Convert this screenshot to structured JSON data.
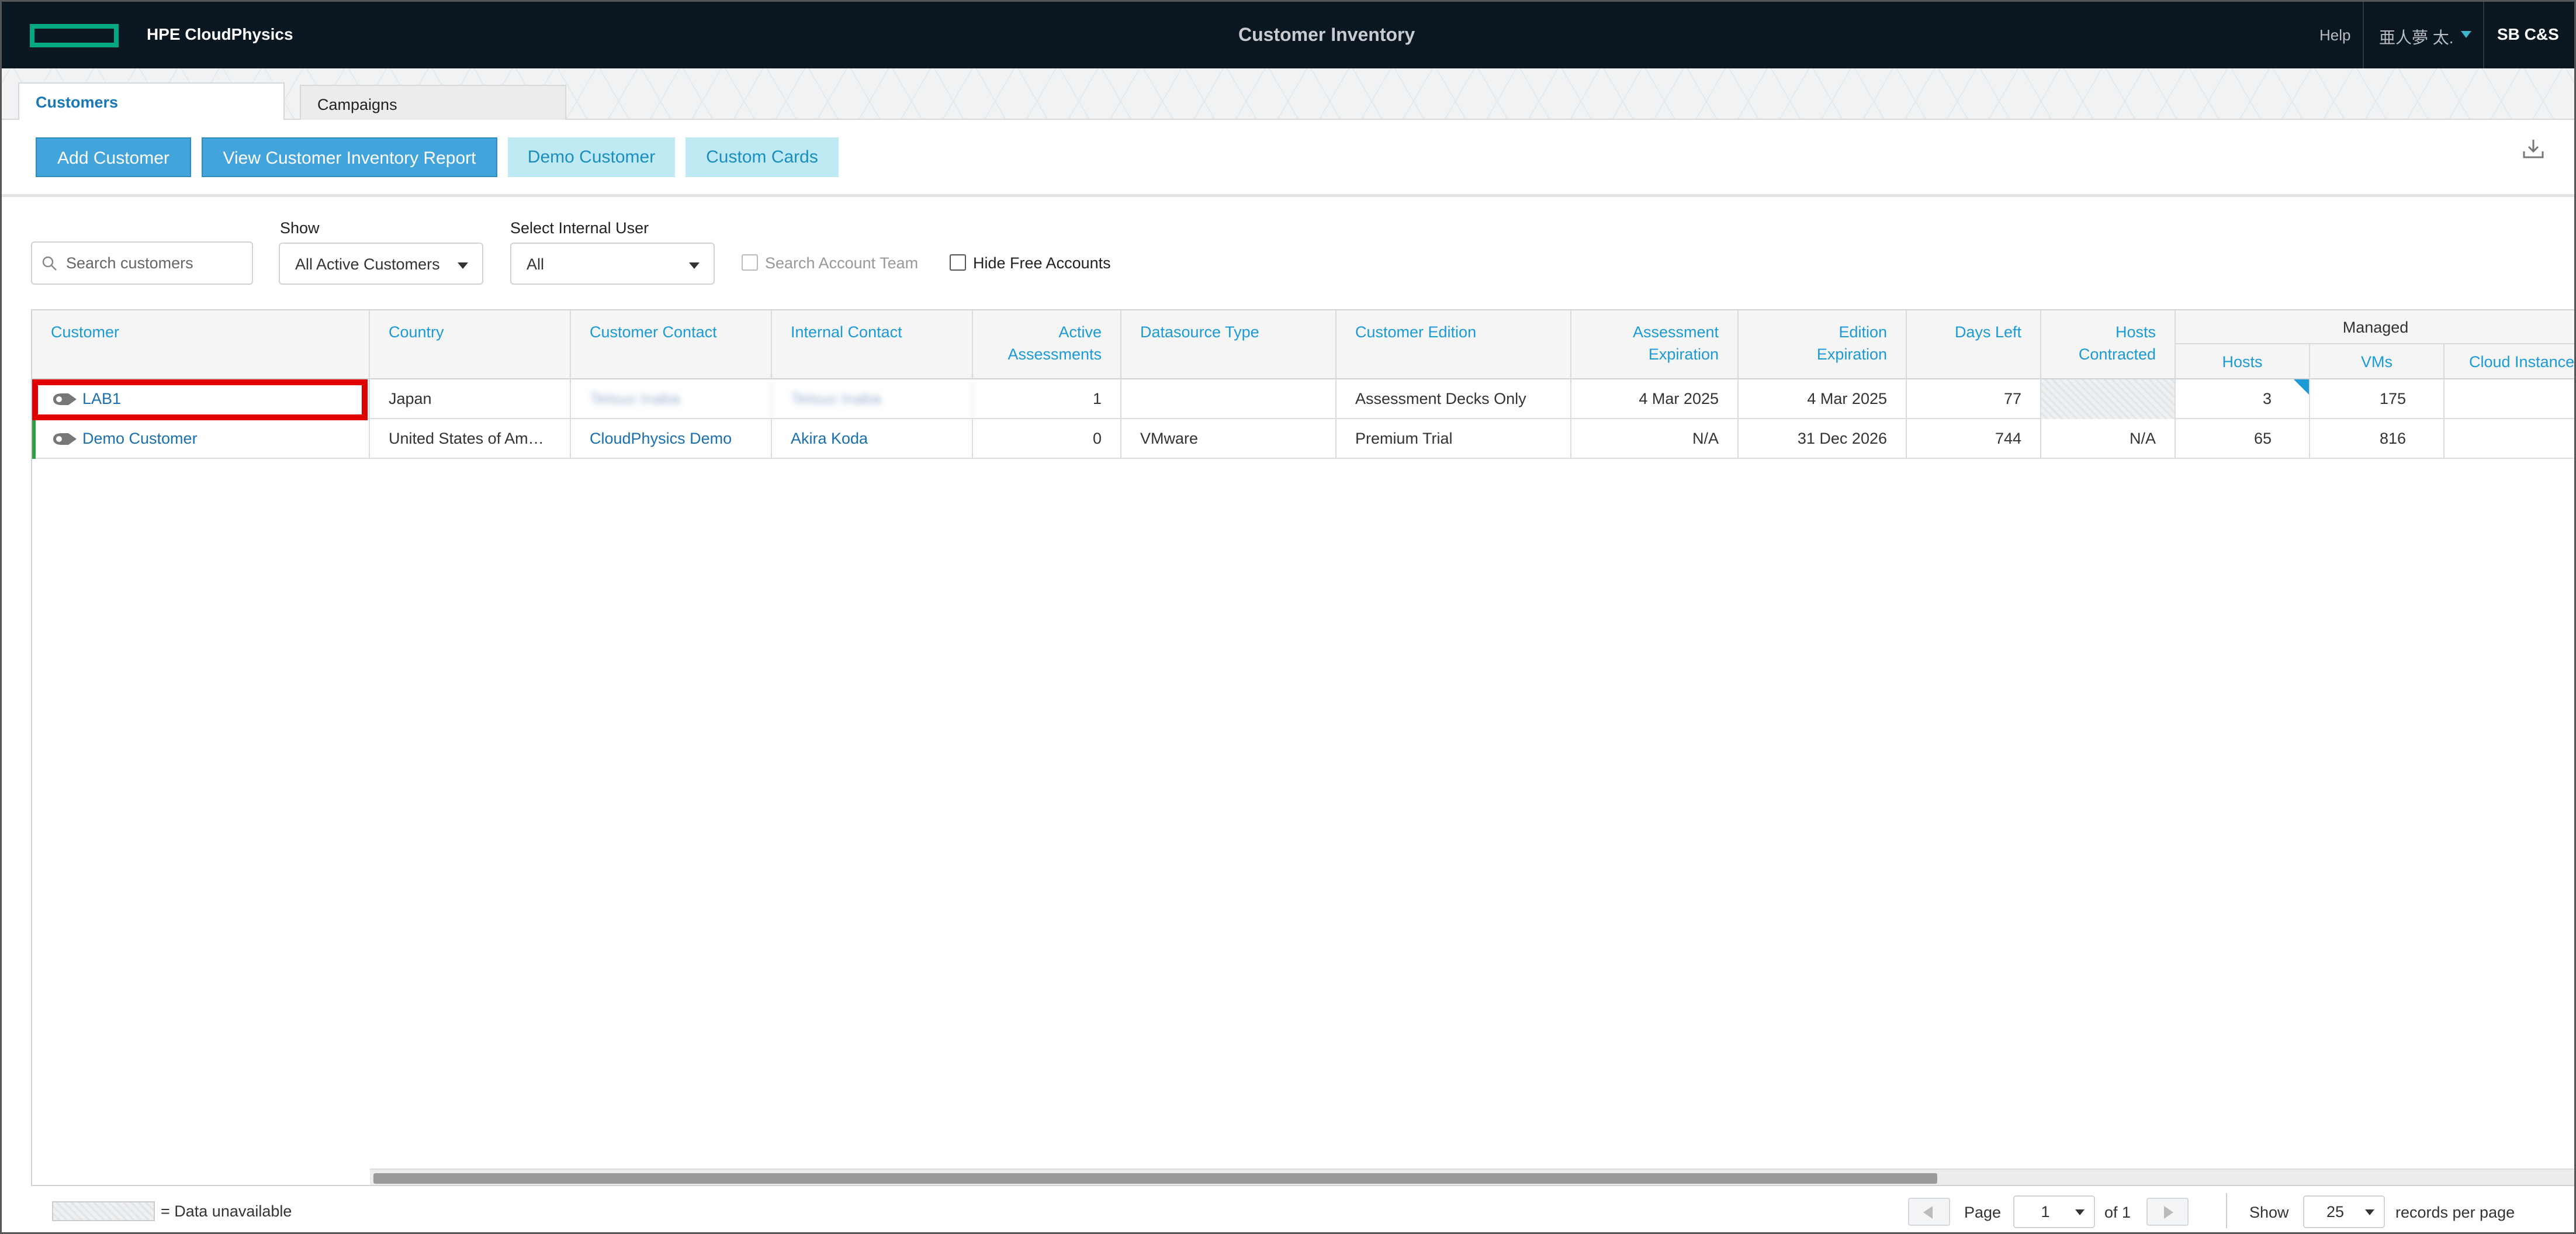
{
  "header": {
    "brand": "HPE CloudPhysics",
    "title": "Customer Inventory",
    "help": "Help",
    "user": "亜人夢 太.",
    "org": "SB C&S"
  },
  "tabs": [
    {
      "label": "Customers",
      "active": true
    },
    {
      "label": "Campaigns",
      "active": false
    }
  ],
  "toolbar": {
    "add_customer": "Add Customer",
    "view_report": "View Customer Inventory Report",
    "demo_customer": "Demo Customer",
    "custom_cards": "Custom Cards",
    "export_icon": "download-icon"
  },
  "filters": {
    "search_placeholder": "Search customers",
    "show_label": "Show",
    "show_value": "All Active Customers",
    "internal_user_label": "Select Internal User",
    "internal_user_value": "All",
    "search_account_team": "Search Account Team",
    "hide_free_accounts": "Hide Free Accounts"
  },
  "grid": {
    "columns": {
      "customer": "Customer",
      "country": "Country",
      "customer_contact": "Customer Contact",
      "internal_contact": "Internal Contact",
      "active_1": "Active",
      "active_2": "Assessments",
      "datasource": "Datasource Type",
      "edition": "Customer Edition",
      "assess_exp_1": "Assessment",
      "assess_exp_2": "Expiration",
      "edition_exp_1": "Edition",
      "edition_exp_2": "Expiration",
      "days_left": "Days Left",
      "hosts_contracted_1": "Hosts",
      "hosts_contracted_2": "Contracted",
      "managed": "Managed",
      "hosts": "Hosts",
      "vms": "VMs",
      "cloud": "Cloud Instances"
    },
    "rows": [
      {
        "customer": "LAB1",
        "country": "Japan",
        "customer_contact": "Tetsuo Inaba",
        "internal_contact": "Tetsuo Inaba",
        "active": "1",
        "datasource": "",
        "edition": "Assessment Decks Only",
        "assess_exp": "4 Mar 2025",
        "edition_exp": "4 Mar 2025",
        "days_left": "77",
        "hosts_contracted": "",
        "hosts": "3",
        "vms": "175",
        "cloud": ""
      },
      {
        "customer": "Demo Customer",
        "country": "United States of America",
        "customer_contact": "CloudPhysics Demo",
        "internal_contact": "Akira Koda",
        "active": "0",
        "datasource": "VMware",
        "edition": "Premium Trial",
        "assess_exp": "N/A",
        "edition_exp": "31 Dec 2026",
        "days_left": "744",
        "hosts_contracted": "N/A",
        "hosts": "65",
        "vms": "816",
        "cloud": ""
      }
    ]
  },
  "footer": {
    "legend": "= Data unavailable",
    "page_label": "Page",
    "page_value": "1",
    "of_label": "of 1",
    "show_label": "Show",
    "per_page_value": "25",
    "records_label": "records per page"
  },
  "colors": {
    "topbar": "#0b1720",
    "logo": "#01a982",
    "primary_button": "#43a4dc",
    "light_button": "#bfe9f3",
    "link": "#1a6fb0",
    "highlight": "#e00000"
  }
}
